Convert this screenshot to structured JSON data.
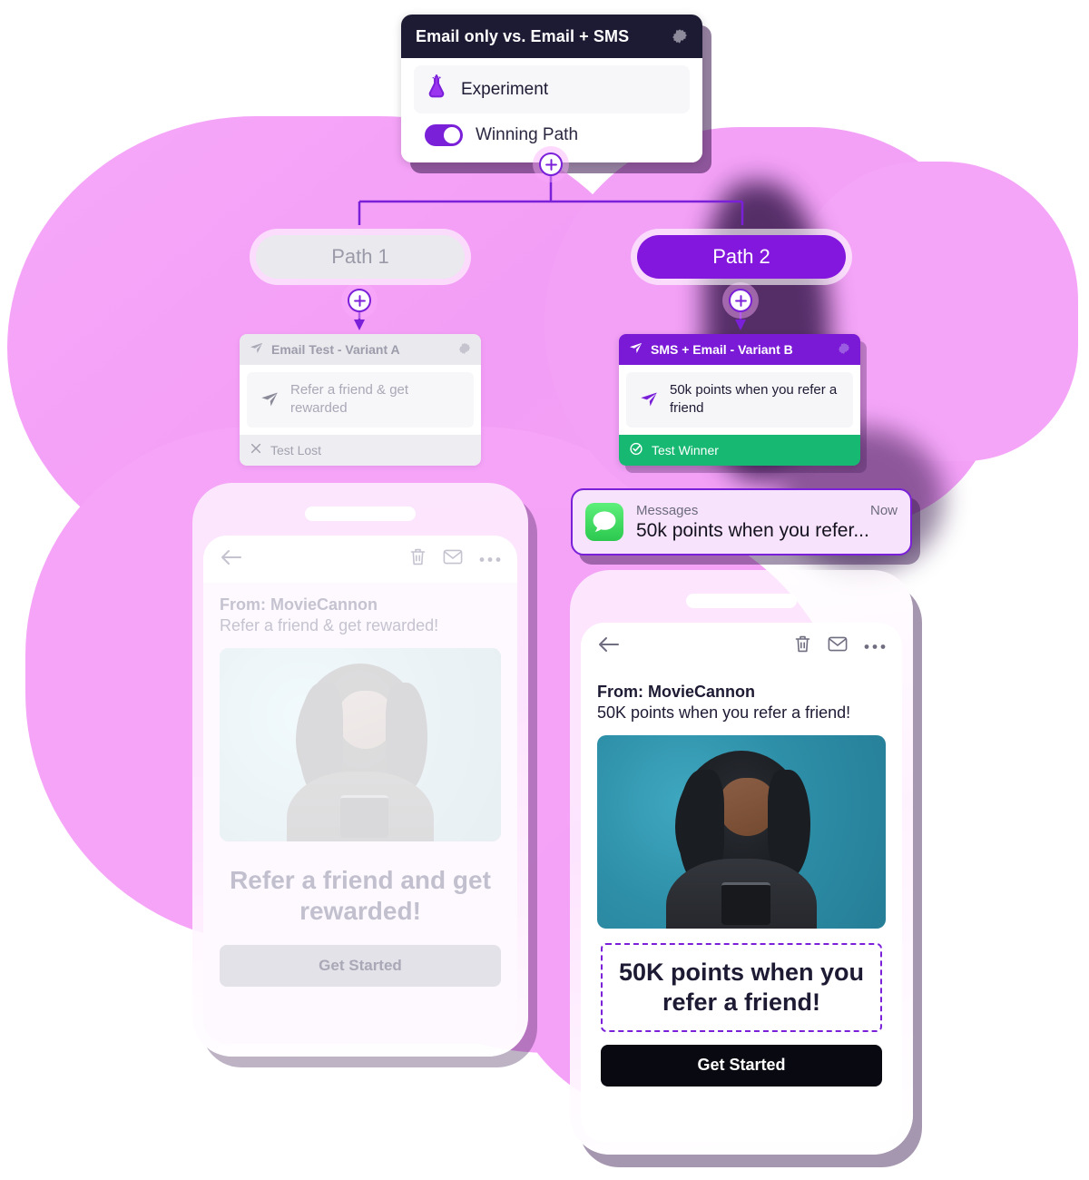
{
  "experiment_card": {
    "title": "Email only vs. Email + SMS",
    "settings_icon": "gear-icon",
    "rows": [
      {
        "icon": "flask-icon",
        "label": "Experiment"
      }
    ],
    "toggle": {
      "label": "Winning Path",
      "state": "on"
    },
    "header_bg": "#1d1a33",
    "accent": "#7a20d9"
  },
  "flow": {
    "add_node_label": "+",
    "paths": [
      {
        "label": "Path 1",
        "state": "inactive",
        "bg": "#e9e9ee",
        "fg": "#9b9aa8"
      },
      {
        "label": "Path 2",
        "state": "active",
        "bg": "#8417dd",
        "fg": "#ffffff"
      }
    ]
  },
  "variants": {
    "a": {
      "header_title": "Email Test - Variant A",
      "header_icon": "send-icon",
      "settings_icon": "gear-icon",
      "message_icon": "send-icon",
      "message_text": "Refer a friend & get rewarded",
      "footer_icon": "close-x-icon",
      "footer_label": "Test Lost",
      "footer_bg": "#eeeef2",
      "header_bg": "#e9e9ee"
    },
    "b": {
      "header_title": "SMS + Email - Variant B",
      "header_icon": "send-icon",
      "settings_icon": "gear-icon",
      "message_icon": "send-icon",
      "message_text": "50k points when you refer a friend",
      "footer_icon": "check-circle-icon",
      "footer_label": "Test Winner",
      "footer_bg": "#17b872",
      "header_bg": "#7a19d6"
    }
  },
  "sms_notification": {
    "app_icon": "messages-icon",
    "app_name": "Messages",
    "time": "Now",
    "body": "50k points when you refer...",
    "border_color": "#7a20d9"
  },
  "phones": {
    "left": {
      "state": "faded",
      "toolbar": {
        "back_icon": "back-arrow-icon",
        "delete_icon": "trash-icon",
        "mail_icon": "envelope-icon",
        "more_icon": "ellipsis-icon"
      },
      "from": "From: MovieCannon",
      "subject": "Refer a friend & get rewarded!",
      "hero_alt": "woman-looking-at-phone-photo",
      "headline": "Refer a friend and get rewarded!",
      "cta_label": "Get Started",
      "cta_bg": "#e3e2e8",
      "cta_fg": "#a9a8b6"
    },
    "right": {
      "state": "active",
      "toolbar": {
        "back_icon": "back-arrow-icon",
        "delete_icon": "trash-icon",
        "mail_icon": "envelope-icon",
        "more_icon": "ellipsis-icon"
      },
      "from": "From: MovieCannon",
      "subject": "50K points when you refer a friend!",
      "hero_alt": "woman-looking-at-phone-photo",
      "headline": "50K points when you refer a friend!",
      "cta_label": "Get Started",
      "cta_bg": "#090911",
      "cta_fg": "#ffffff"
    }
  },
  "theme": {
    "blob_pink": "#f4a3f7",
    "purple": "#7a20d9",
    "green": "#17b872",
    "dark": "#1d1a33"
  }
}
